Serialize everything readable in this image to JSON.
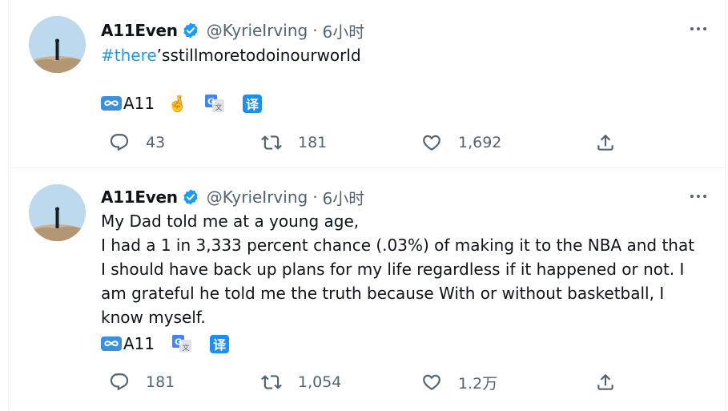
{
  "tweets": [
    {
      "author_name": "A11Even",
      "handle": "@KyrieIrving",
      "separator": "·",
      "time": "6小时",
      "hashtag": "#there",
      "text_rest": "’sstillmoretodoinourworld",
      "signature": "A11",
      "translate_label": "译",
      "stats": {
        "replies": "43",
        "retweets": "181",
        "likes": "1,692"
      }
    },
    {
      "author_name": "A11Even",
      "handle": "@KyrieIrving",
      "separator": "·",
      "time": "6小时",
      "text_line1": "My Dad told me at a young age,",
      "text_line2": "I had a 1 in 3,333 percent chance (.03%) of making it to the NBA and that I should have back up plans for my life regardless if it happened or not. I am grateful he told me the truth because With or without basketball, I know myself.",
      "signature": "A11",
      "translate_label": "译",
      "stats": {
        "replies": "181",
        "retweets": "1,054",
        "likes": "1.2万"
      }
    }
  ],
  "icons": {
    "verified": "verified-badge-icon",
    "more": "more-options-icon",
    "reply": "reply-icon",
    "retweet": "retweet-icon",
    "like": "heart-icon",
    "share": "share-icon",
    "infinity": "infinity-emoji-icon",
    "crossed_fingers": "crossed-fingers-emoji",
    "google_translate": "google-translate-icon"
  },
  "colors": {
    "accent": "#1d9bf0",
    "muted": "#536471",
    "text": "#0f1419"
  }
}
